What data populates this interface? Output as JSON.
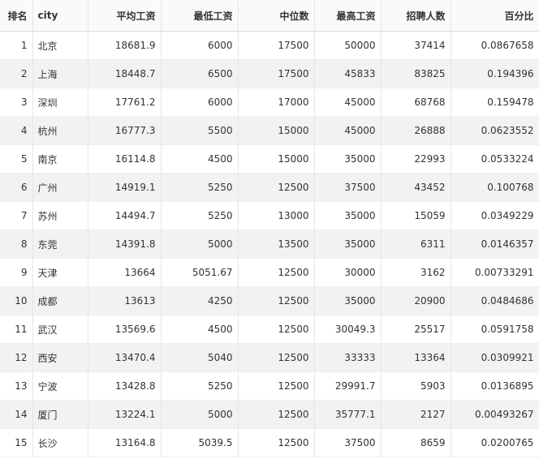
{
  "table": {
    "headers": {
      "rank": "排名",
      "city": "city",
      "avg": "平均工资",
      "min": "最低工资",
      "median": "中位数",
      "max": "最高工资",
      "count": "招聘人数",
      "pct": "百分比"
    },
    "rows": [
      {
        "rank": "1",
        "city": "北京",
        "avg": "18681.9",
        "min": "6000",
        "median": "17500",
        "max": "50000",
        "count": "37414",
        "pct": "0.0867658"
      },
      {
        "rank": "2",
        "city": "上海",
        "avg": "18448.7",
        "min": "6500",
        "median": "17500",
        "max": "45833",
        "count": "83825",
        "pct": "0.194396"
      },
      {
        "rank": "3",
        "city": "深圳",
        "avg": "17761.2",
        "min": "6000",
        "median": "17000",
        "max": "45000",
        "count": "68768",
        "pct": "0.159478"
      },
      {
        "rank": "4",
        "city": "杭州",
        "avg": "16777.3",
        "min": "5500",
        "median": "15000",
        "max": "45000",
        "count": "26888",
        "pct": "0.0623552"
      },
      {
        "rank": "5",
        "city": "南京",
        "avg": "16114.8",
        "min": "4500",
        "median": "15000",
        "max": "35000",
        "count": "22993",
        "pct": "0.0533224"
      },
      {
        "rank": "6",
        "city": "广州",
        "avg": "14919.1",
        "min": "5250",
        "median": "12500",
        "max": "37500",
        "count": "43452",
        "pct": "0.100768"
      },
      {
        "rank": "7",
        "city": "苏州",
        "avg": "14494.7",
        "min": "5250",
        "median": "13000",
        "max": "35000",
        "count": "15059",
        "pct": "0.0349229"
      },
      {
        "rank": "8",
        "city": "东莞",
        "avg": "14391.8",
        "min": "5000",
        "median": "13500",
        "max": "35000",
        "count": "6311",
        "pct": "0.0146357"
      },
      {
        "rank": "9",
        "city": "天津",
        "avg": "13664",
        "min": "5051.67",
        "median": "12500",
        "max": "30000",
        "count": "3162",
        "pct": "0.00733291"
      },
      {
        "rank": "10",
        "city": "成都",
        "avg": "13613",
        "min": "4250",
        "median": "12500",
        "max": "35000",
        "count": "20900",
        "pct": "0.0484686"
      },
      {
        "rank": "11",
        "city": "武汉",
        "avg": "13569.6",
        "min": "4500",
        "median": "12500",
        "max": "30049.3",
        "count": "25517",
        "pct": "0.0591758"
      },
      {
        "rank": "12",
        "city": "西安",
        "avg": "13470.4",
        "min": "5040",
        "median": "12500",
        "max": "33333",
        "count": "13364",
        "pct": "0.0309921"
      },
      {
        "rank": "13",
        "city": "宁波",
        "avg": "13428.8",
        "min": "5250",
        "median": "12500",
        "max": "29991.7",
        "count": "5903",
        "pct": "0.0136895"
      },
      {
        "rank": "14",
        "city": "厦门",
        "avg": "13224.1",
        "min": "5000",
        "median": "12500",
        "max": "35777.1",
        "count": "2127",
        "pct": "0.00493267"
      },
      {
        "rank": "15",
        "city": "长沙",
        "avg": "13164.8",
        "min": "5039.5",
        "median": "12500",
        "max": "37500",
        "count": "8659",
        "pct": "0.0200765"
      }
    ]
  }
}
